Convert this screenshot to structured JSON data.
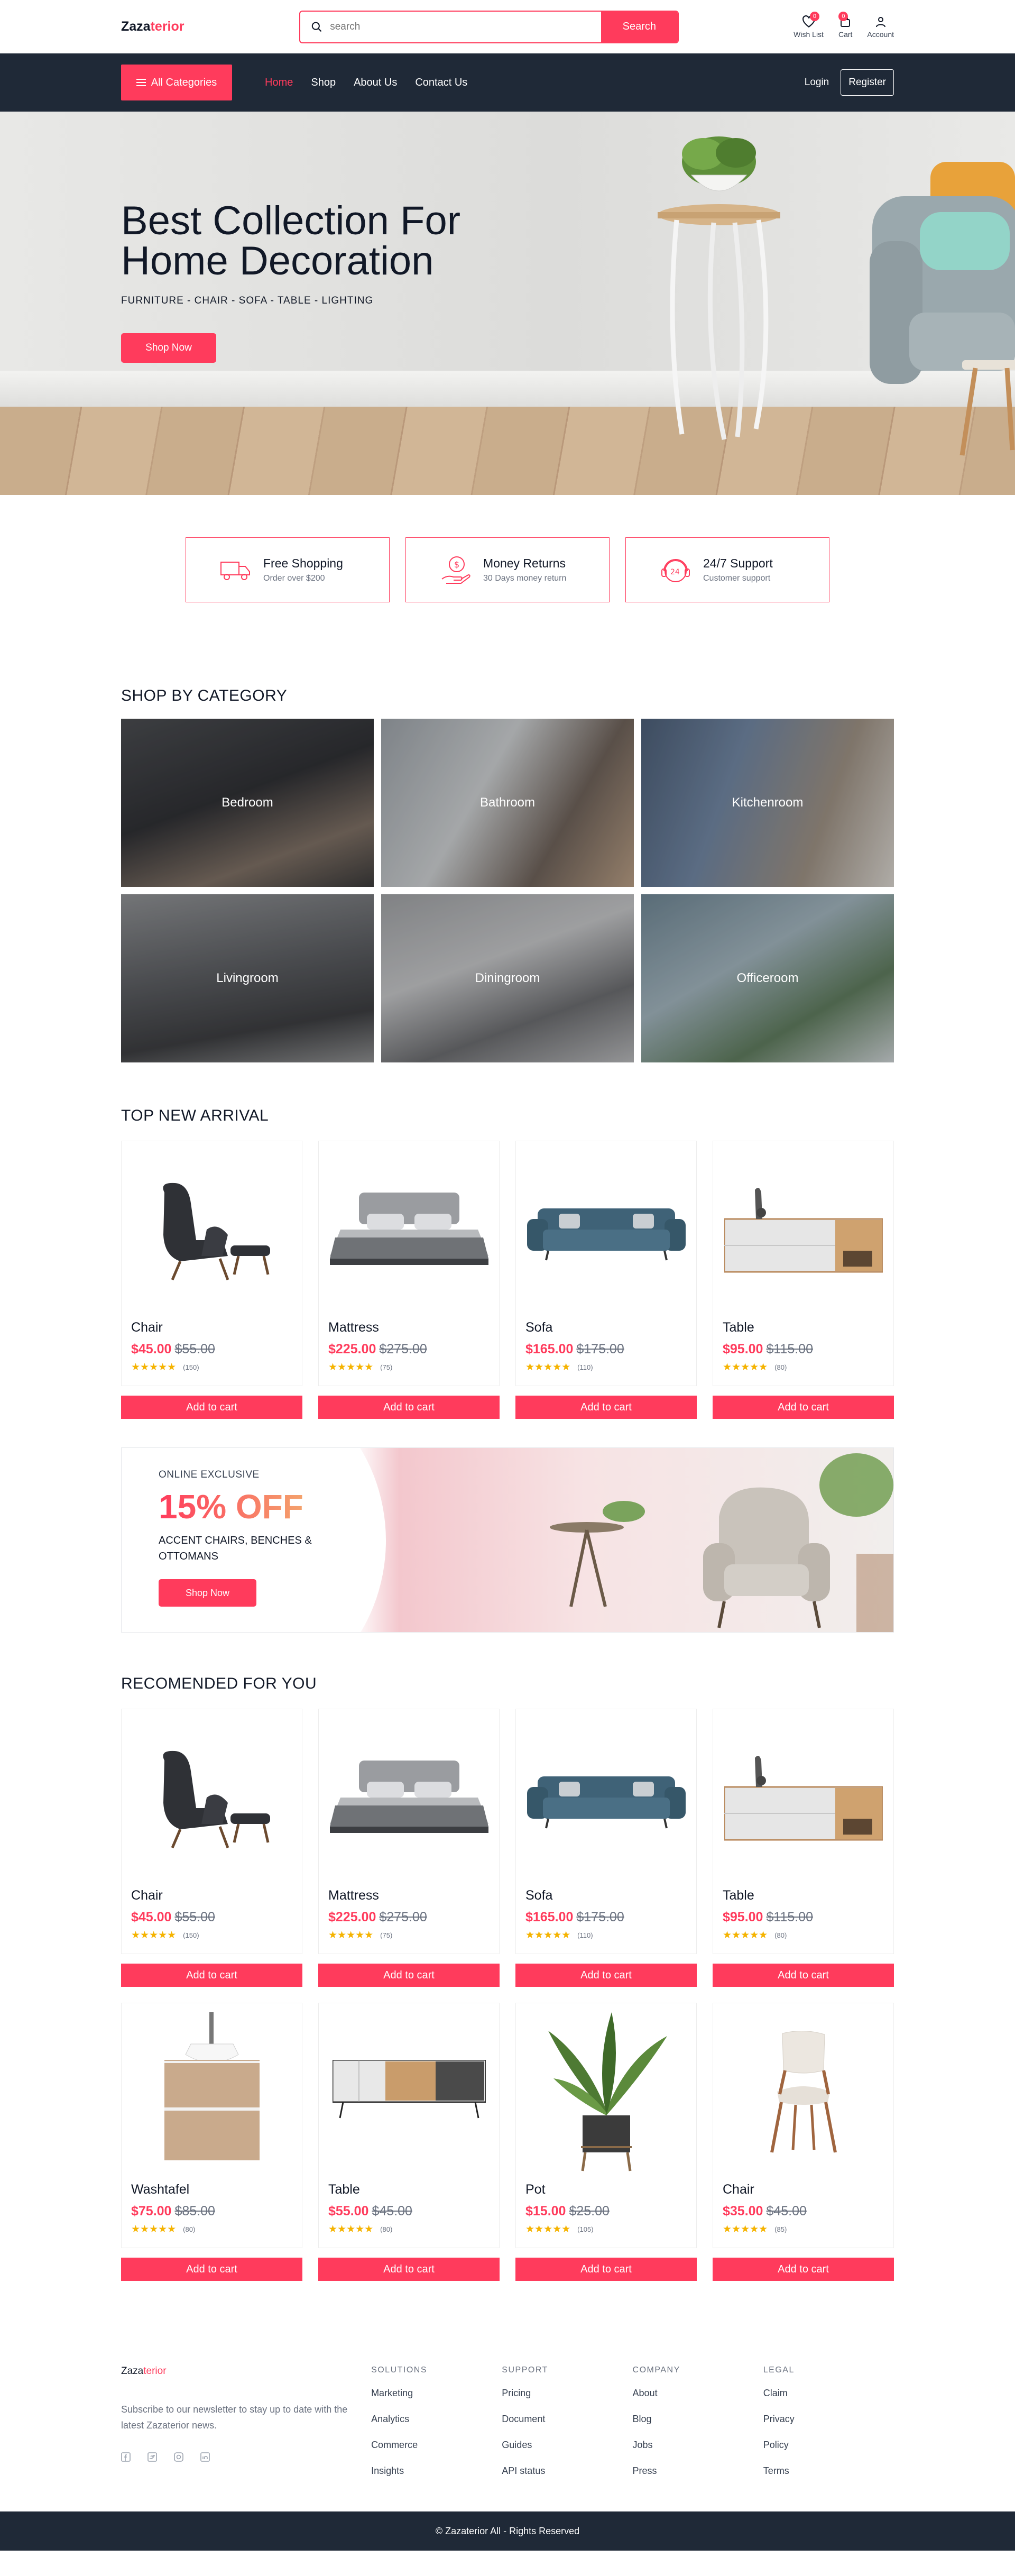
{
  "header": {
    "logo_dark": "Zaza",
    "logo_accent": "terior",
    "search_placeholder": "search",
    "search_button": "Search",
    "wishlist_label": "Wish List",
    "wishlist_count": "0",
    "cart_label": "Cart",
    "cart_count": "0",
    "account_label": "Account"
  },
  "nav": {
    "all_categories": "All Categories",
    "items": [
      "Home",
      "Shop",
      "About Us",
      "Contact Us"
    ],
    "login": "Login",
    "register": "Register"
  },
  "hero": {
    "title": "Best Collection For Home Decoration",
    "subtitle": "FURNITURE - CHAIR - SOFA - TABLE - LIGHTING",
    "button": "Shop Now"
  },
  "features": [
    {
      "title": "Free Shopping",
      "subtitle": "Order over $200",
      "icon": "truck-icon"
    },
    {
      "title": "Money Returns",
      "subtitle": "30 Days money return",
      "icon": "money-hand-icon"
    },
    {
      "title": "24/7 Support",
      "subtitle": "Customer support",
      "icon": "support-24-icon"
    }
  ],
  "categories": {
    "title": "SHOP BY CATEGORY",
    "items": [
      "Bedroom",
      "Bathroom",
      "Kitchenroom",
      "Livingroom",
      "Diningroom",
      "Officeroom"
    ]
  },
  "arrivals": {
    "title": "TOP NEW ARRIVAL",
    "add_label": "Add to cart",
    "items": [
      {
        "name": "Chair",
        "price": "$45.00",
        "old": "$55.00",
        "reviews": "(150)"
      },
      {
        "name": "Mattress",
        "price": "$225.00",
        "old": "$275.00",
        "reviews": "(75)"
      },
      {
        "name": "Sofa",
        "price": "$165.00",
        "old": "$175.00",
        "reviews": "(110)"
      },
      {
        "name": "Table",
        "price": "$95.00",
        "old": "$115.00",
        "reviews": "(80)"
      }
    ]
  },
  "banner": {
    "kicker": "ONLINE EXCLUSIVE",
    "headline": "15% OFF",
    "desc": "ACCENT CHAIRS, BENCHES & OTTOMANS",
    "button": "Shop Now"
  },
  "recommended": {
    "title": "RECOMENDED FOR YOU",
    "add_label": "Add to cart",
    "items": [
      {
        "name": "Chair",
        "price": "$45.00",
        "old": "$55.00",
        "reviews": "(150)"
      },
      {
        "name": "Mattress",
        "price": "$225.00",
        "old": "$275.00",
        "reviews": "(75)"
      },
      {
        "name": "Sofa",
        "price": "$165.00",
        "old": "$175.00",
        "reviews": "(110)"
      },
      {
        "name": "Table",
        "price": "$95.00",
        "old": "$115.00",
        "reviews": "(80)"
      },
      {
        "name": "Washtafel",
        "price": "$75.00",
        "old": "$85.00",
        "reviews": "(80)"
      },
      {
        "name": "Table",
        "price": "$55.00",
        "old": "$45.00",
        "reviews": "(80)"
      },
      {
        "name": "Pot",
        "price": "$15.00",
        "old": "$25.00",
        "reviews": "(105)"
      },
      {
        "name": "Chair",
        "price": "$35.00",
        "old": "$45.00",
        "reviews": "(85)"
      }
    ]
  },
  "footer": {
    "logo_dark": "Zaza",
    "logo_accent": "terior",
    "about": "Subscribe to our newsletter to stay up to date with the latest Zazaterior news.",
    "columns": [
      {
        "title": "SOLUTIONS",
        "links": [
          "Marketing",
          "Analytics",
          "Commerce",
          "Insights"
        ]
      },
      {
        "title": "SUPPORT",
        "links": [
          "Pricing",
          "Document",
          "Guides",
          "API status"
        ]
      },
      {
        "title": "COMPANY",
        "links": [
          "About",
          "Blog",
          "Jobs",
          "Press"
        ]
      },
      {
        "title": "LEGAL",
        "links": [
          "Claim",
          "Privacy",
          "Policy",
          "Terms"
        ]
      }
    ],
    "copyright": "© Zazaterior All - Rights Reserved"
  },
  "colors": {
    "accent": "#ff3b5c",
    "dark": "#1f2937",
    "star": "#f5b300"
  }
}
